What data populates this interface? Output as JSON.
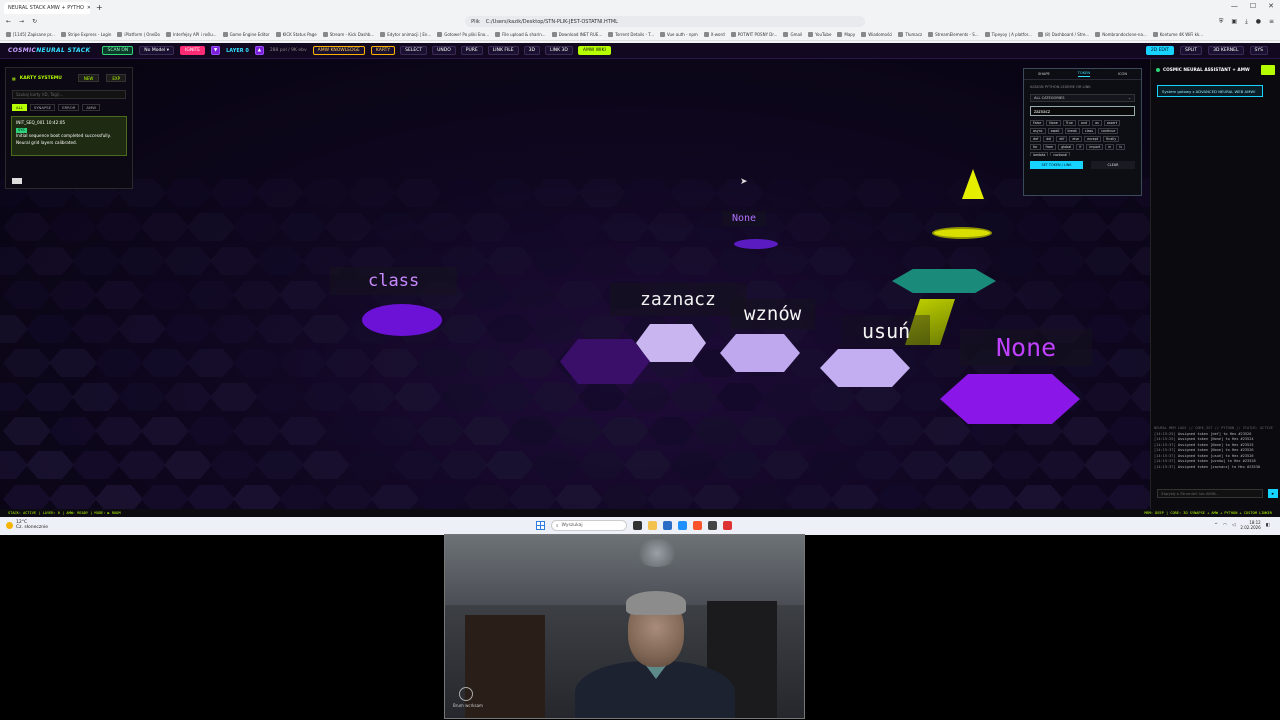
{
  "browser": {
    "tab_title": "NEURAL STACK AMW + PYTHO",
    "url_prefix": "Plik",
    "url": "C:/Users/kazik/Desktop/STN-PLIK-JEST-OSTATNI.HTML",
    "bookmarks": [
      "[1145] Zapisane pr...",
      "Stripe Express - Login",
      "iPlatform | OneDo",
      "Interfejsy API i roślu...",
      "Game Engine Editor",
      "KICK Status Page",
      "Stream - Kick Dashb...",
      "Edytor animacji | En...",
      "Gotowe! Po pliki Eno...",
      "File upload & sharin...",
      "Download INET RUE...",
      "Torrent Details - T...",
      "Vue auth - npm",
      "X-word",
      "POTWIT POSNY Dr...",
      "Gmail",
      "YouTube",
      "Mapy",
      "Wiadomości",
      "Tłumacz",
      "StreamElements - S...",
      "Tipeyoy | A platfor...",
      "(8) Dashboard / Stre...",
      "Nombrandoclone-na...",
      "Kontume 4K WiFi kk..."
    ]
  },
  "topbar": {
    "brand_a": "COSMIC",
    "brand_b": "NEURAL STACK",
    "scan": "SCAN ON",
    "model": "No Model ▾",
    "ignite": "IGNITE",
    "layer": "LAYER 0",
    "layer_meta": "288 pol / 9K ebv",
    "amw_knowledge": "AMW KNOWLEDGE",
    "buttons": [
      "KARTY",
      "SELECT",
      "UNDO",
      "PURE",
      "LINK FILE",
      "3D",
      "LINK 3D",
      "AMW WIKI"
    ],
    "right": [
      "2D EDIT",
      "SPLIT",
      "3D KERNEL",
      "SYS"
    ]
  },
  "left_panel": {
    "title": "KARTY SYSTEMU",
    "new_btn": "NEW",
    "exp_btn": "EXP",
    "search_placeholder": "Szukaj karty (ID, Tagi)...",
    "filters": [
      "ALL",
      "SYNAPSE",
      "ERROR",
      "AMW"
    ],
    "card_id": "INIT_SEQ_001 10:42:05",
    "card_badge": "SYS",
    "card_text": "Initial sequence boot completed successfully. Neural grid layers calibrated."
  },
  "token_panel": {
    "tabs": [
      "SHAPE",
      "TOKEN",
      "ICON"
    ],
    "label": "ASSIGN PYTHON LEXEME OR LINK",
    "category": "ALL CATEGORIES",
    "input_value": "zaznacz",
    "keywords": [
      "False",
      "None",
      "True",
      "and",
      "as",
      "assert",
      "async",
      "await",
      "break",
      "class",
      "continue",
      "def",
      "del",
      "elif",
      "else",
      "except",
      "finally",
      "for",
      "from",
      "global",
      "if",
      "import",
      "in",
      "is",
      "lambda",
      "nonlocal"
    ],
    "set_btn": "SET TOKEN / LINK",
    "clear_btn": "CLEAR"
  },
  "scene": {
    "labels": [
      "None",
      "class",
      "zaznacz",
      "wznów",
      "usuń",
      "None"
    ]
  },
  "right_panel": {
    "title": "COSMIC NEURAL ASSISTANT + AMW",
    "message": "System gotowy z ADVANCED NEURAL WEB AMW!",
    "log_header": "NEURAL MEM LOGS // CORE_3ST // PYTHON // STATUS: ACTIVE",
    "log": [
      {
        "time": "[14:15:25]",
        "text": "Assigned token [def] to Hex #23526"
      },
      {
        "time": "[14:15:25]",
        "text": "Assigned token [None] to Hex #23524"
      },
      {
        "time": "[14:15:37]",
        "text": "Assigned token [None] to Hex #23525"
      },
      {
        "time": "[14:15:37]",
        "text": "Assigned token [None] to Hex #23526"
      },
      {
        "time": "[14:15:37]",
        "text": "Assigned token [usuń] to Hex #23526"
      },
      {
        "time": "[14:15:37]",
        "text": "Assigned token [wznów] to Hex #23528"
      },
      {
        "time": "[14:15:37]",
        "text": "Assigned token [zaznacz] to Hex #23530"
      }
    ],
    "input_placeholder": "Zapytaj o Strumień lub AMW...",
    "send": "▸"
  },
  "statusbar": {
    "left": "STACK: ACTIVE | LAYER: 0 | AMW: READY | MODE: ▶ ROOM",
    "right": "MEM: DEEP | CORE: 3D SYNAPSE + AMW + PYTHON + CUSTOM LINKER"
  },
  "taskbar": {
    "temp": "12°C",
    "weather": "Cz. słonecznie",
    "search": "Wyszukaj",
    "time": "18:12",
    "date": "2.02.2026"
  },
  "webcam": {
    "label": "Brum wcrksam"
  },
  "colors": {
    "accent_lime": "#b6ff00",
    "accent_cyan": "#17d3ff",
    "accent_purple": "#7a1fd8",
    "accent_pink": "#ff2b74"
  }
}
